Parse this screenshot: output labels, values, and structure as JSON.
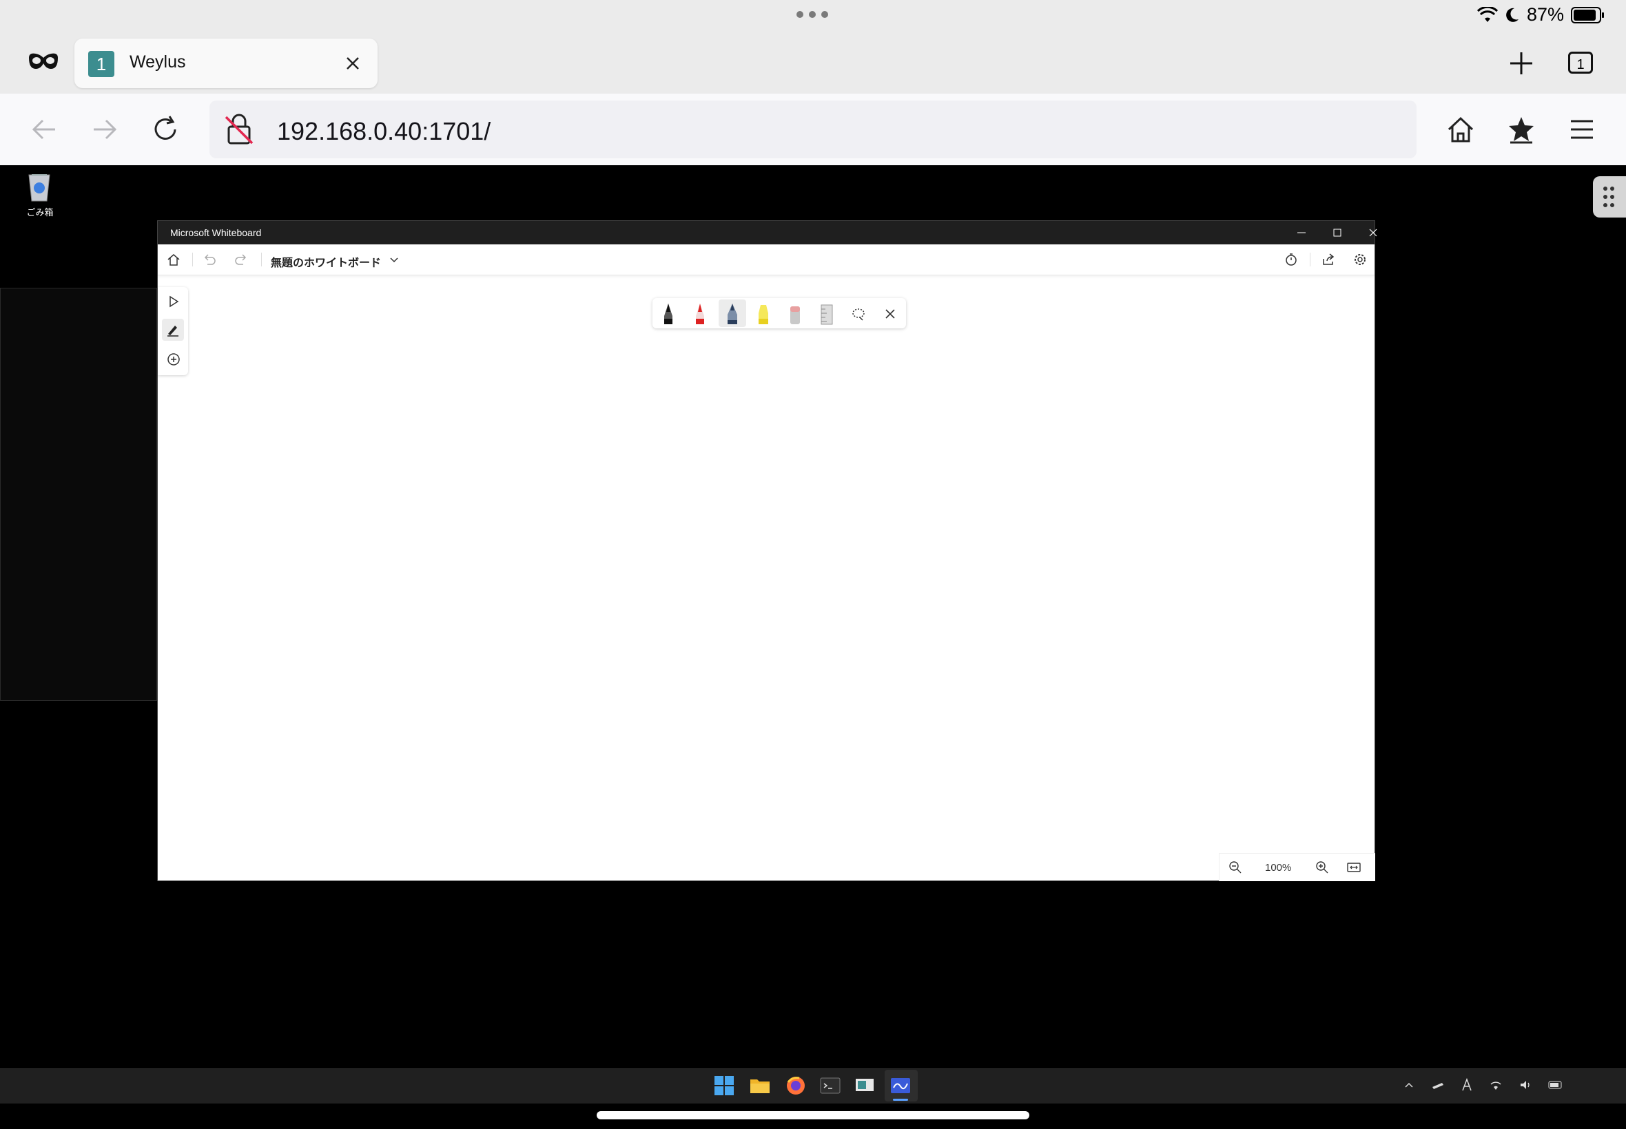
{
  "status_bar": {
    "battery_percent": "87%"
  },
  "browser": {
    "tab": {
      "index": "1",
      "title": "Weylus"
    },
    "tab_count": "1",
    "url": "192.168.0.40:1701/"
  },
  "desktop": {
    "recycle_bin_label": "ごみ箱"
  },
  "whiteboard": {
    "window_title": "Microsoft Whiteboard",
    "board_name": "無題のホワイトボード",
    "zoom": "100%",
    "pens": [
      "black-pen",
      "red-pen",
      "blue-pen",
      "yellow-highlighter",
      "eraser",
      "ruler",
      "lasso",
      "close"
    ]
  },
  "taskbar": {
    "apps": [
      "start-icon",
      "file-explorer-icon",
      "firefox-icon",
      "terminal-icon",
      "weylus-icon",
      "whiteboard-icon"
    ]
  }
}
